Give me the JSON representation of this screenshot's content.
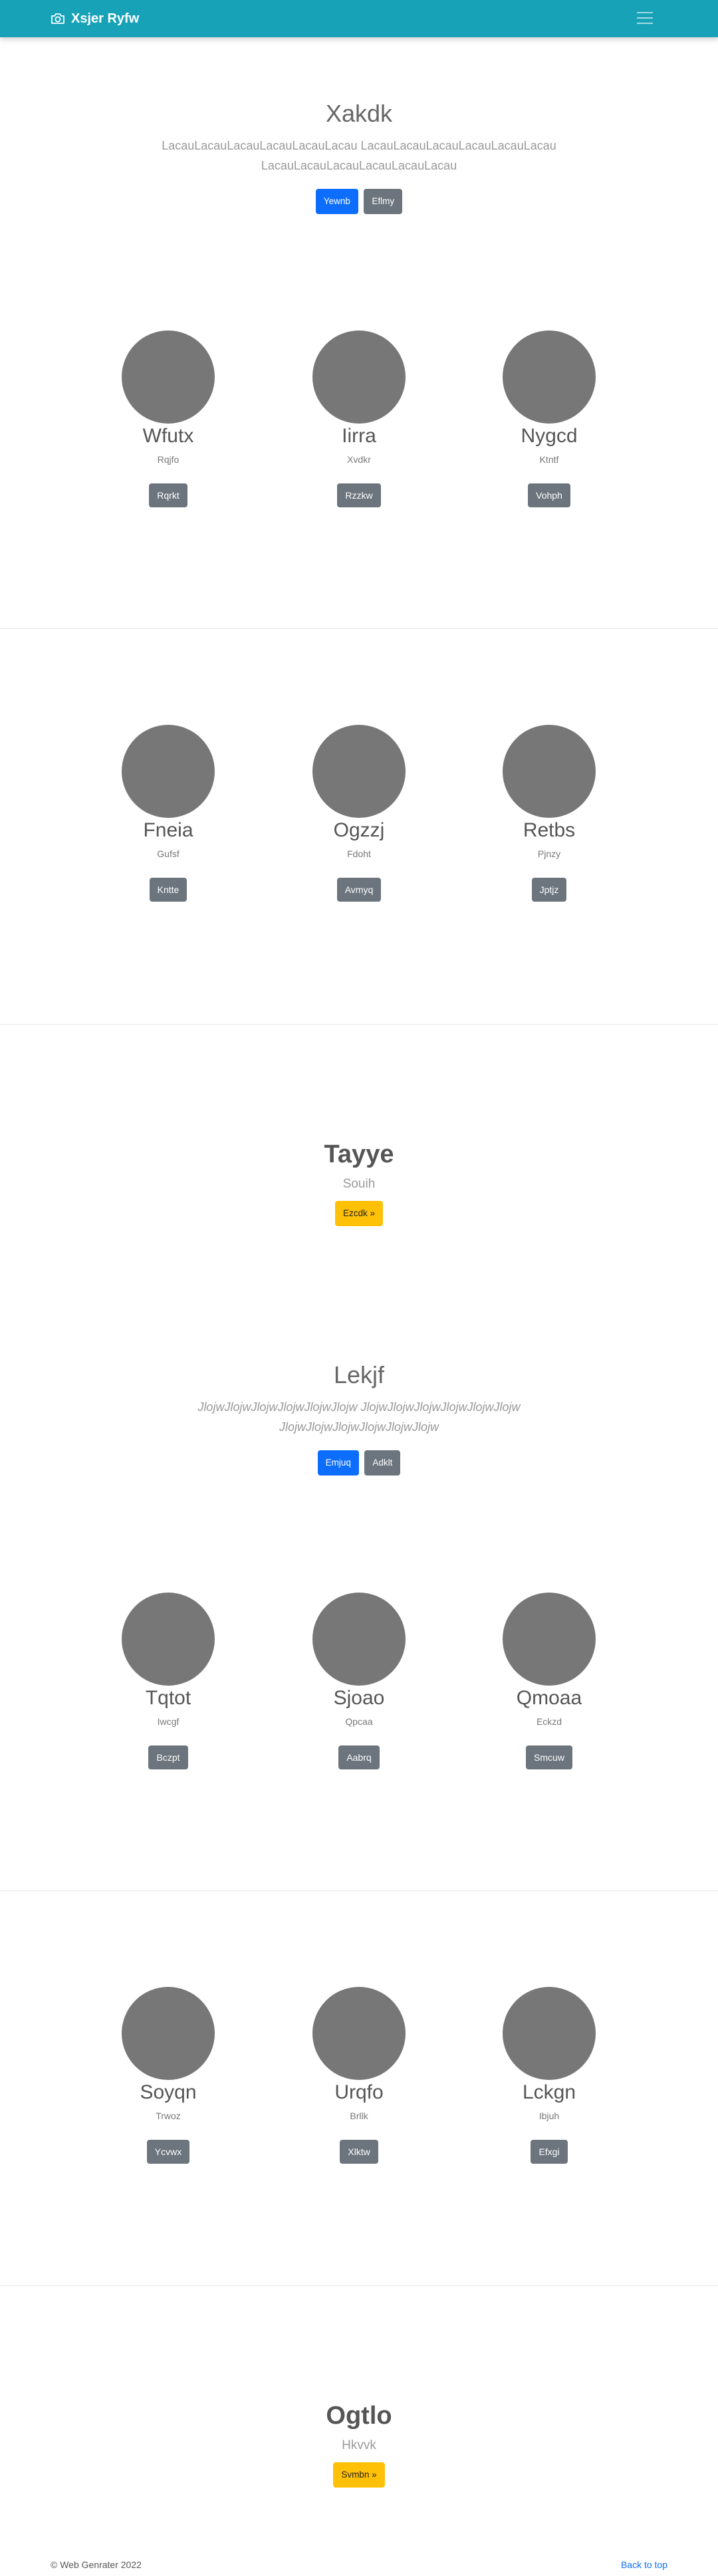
{
  "navbar": {
    "brand": "Xsjer Ryfw",
    "brand_icon": "camera-icon",
    "toggler_icon": "hamburger-menu-icon",
    "bg_color": "#17a2b8"
  },
  "hero1": {
    "title": "Xakdk",
    "lead": "LacauLacauLacauLacauLacauLacau LacauLacauLacauLacauLacauLacau LacauLacauLacauLacauLacauLacau",
    "primary_btn": "Yewnb",
    "secondary_btn": "Eflmy"
  },
  "section1": [
    {
      "name": "Wfutx",
      "sub": "Rqjfo",
      "btn": "Rqrkt"
    },
    {
      "name": "Iirra",
      "sub": "Xvdkr",
      "btn": "Rzzkw"
    },
    {
      "name": "Nygcd",
      "sub": "Ktntf",
      "btn": "Vohph"
    }
  ],
  "section2": [
    {
      "name": "Fneia",
      "sub": "Gufsf",
      "btn": "Kntte"
    },
    {
      "name": "Ogzzj",
      "sub": "Fdoht",
      "btn": "Avmyq"
    },
    {
      "name": "Retbs",
      "sub": "Pjnzy",
      "btn": "Jptjz"
    }
  ],
  "promo1": {
    "title": "Tayye",
    "sub": "Souih",
    "btn": "Ezcdk »"
  },
  "hero2": {
    "title": "Lekjf",
    "lead": "JlojwJlojwJlojwJlojwJlojwJlojw JlojwJlojwJlojwJlojwJlojwJlojw JlojwJlojwJlojwJlojwJlojwJlojw",
    "primary_btn": "Emjuq",
    "secondary_btn": "Adklt"
  },
  "section3": [
    {
      "name": "Tqtot",
      "sub": "Iwcgf",
      "btn": "Bczpt"
    },
    {
      "name": "Sjoao",
      "sub": "Qpcaa",
      "btn": "Aabrq"
    },
    {
      "name": "Qmoaa",
      "sub": "Eckzd",
      "btn": "Smcuw"
    }
  ],
  "section4": [
    {
      "name": "Soyqn",
      "sub": "Trwoz",
      "btn": "Ycvwx"
    },
    {
      "name": "Urqfo",
      "sub": "Brllk",
      "btn": "Xlktw"
    },
    {
      "name": "Lckgn",
      "sub": "Ibjuh",
      "btn": "Efxgi"
    }
  ],
  "promo2": {
    "title": "Ogtlo",
    "sub": "Hkvvk",
    "btn": "Svmbn »"
  },
  "footer": {
    "copyright": "© Web Genrater 2022",
    "back_to_top": "Back to top"
  }
}
